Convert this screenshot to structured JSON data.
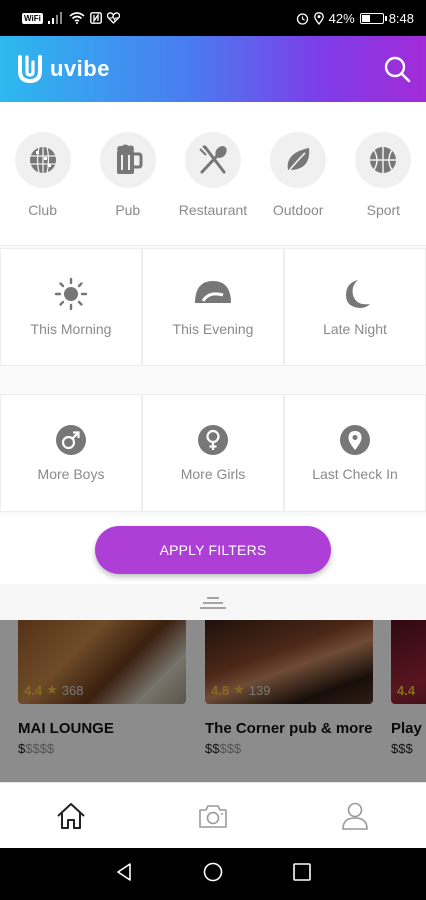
{
  "status_bar": {
    "wifi_label": "WiFi",
    "battery_percent": "42%",
    "battery_level": 0.42,
    "time": "8:48"
  },
  "header": {
    "app_name": "uvibe",
    "brand_gradient": [
      "#2db9ef",
      "#a22bd8"
    ]
  },
  "categories": [
    {
      "label": "Club",
      "icon": "disco-ball-icon"
    },
    {
      "label": "Pub",
      "icon": "beer-mug-icon"
    },
    {
      "label": "Restaurant",
      "icon": "fork-spoon-icon"
    },
    {
      "label": "Outdoor",
      "icon": "leaf-icon"
    },
    {
      "label": "Sport",
      "icon": "basketball-icon"
    }
  ],
  "times": [
    {
      "label": "This Morning",
      "icon": "sun-icon"
    },
    {
      "label": "This Evening",
      "icon": "sunset-icon"
    },
    {
      "label": "Late Night",
      "icon": "moon-icon"
    }
  ],
  "crowd": [
    {
      "label": "More Boys",
      "icon": "male-icon"
    },
    {
      "label": "More Girls",
      "icon": "female-icon"
    },
    {
      "label": "Last Check In",
      "icon": "location-pin-icon"
    }
  ],
  "apply_button": {
    "label": "APPLY FILTERS",
    "color": "#ad3fd7"
  },
  "places": [
    {
      "name": "MAI LOUNGE",
      "rating": "4.4",
      "reviews": "368",
      "price_active": "$",
      "price_inactive": "$$$$"
    },
    {
      "name": "The Corner pub & more",
      "rating": "4.8",
      "reviews": "139",
      "price_active": "$$",
      "price_inactive": "$$$"
    },
    {
      "name": "Play C",
      "rating": "4.4",
      "reviews": "",
      "price_active": "$$$",
      "price_inactive": ""
    }
  ],
  "bottom_nav": [
    {
      "name": "home",
      "icon": "home-icon",
      "active": true
    },
    {
      "name": "camera",
      "icon": "camera-icon",
      "active": false
    },
    {
      "name": "profile",
      "icon": "user-icon",
      "active": false
    }
  ]
}
